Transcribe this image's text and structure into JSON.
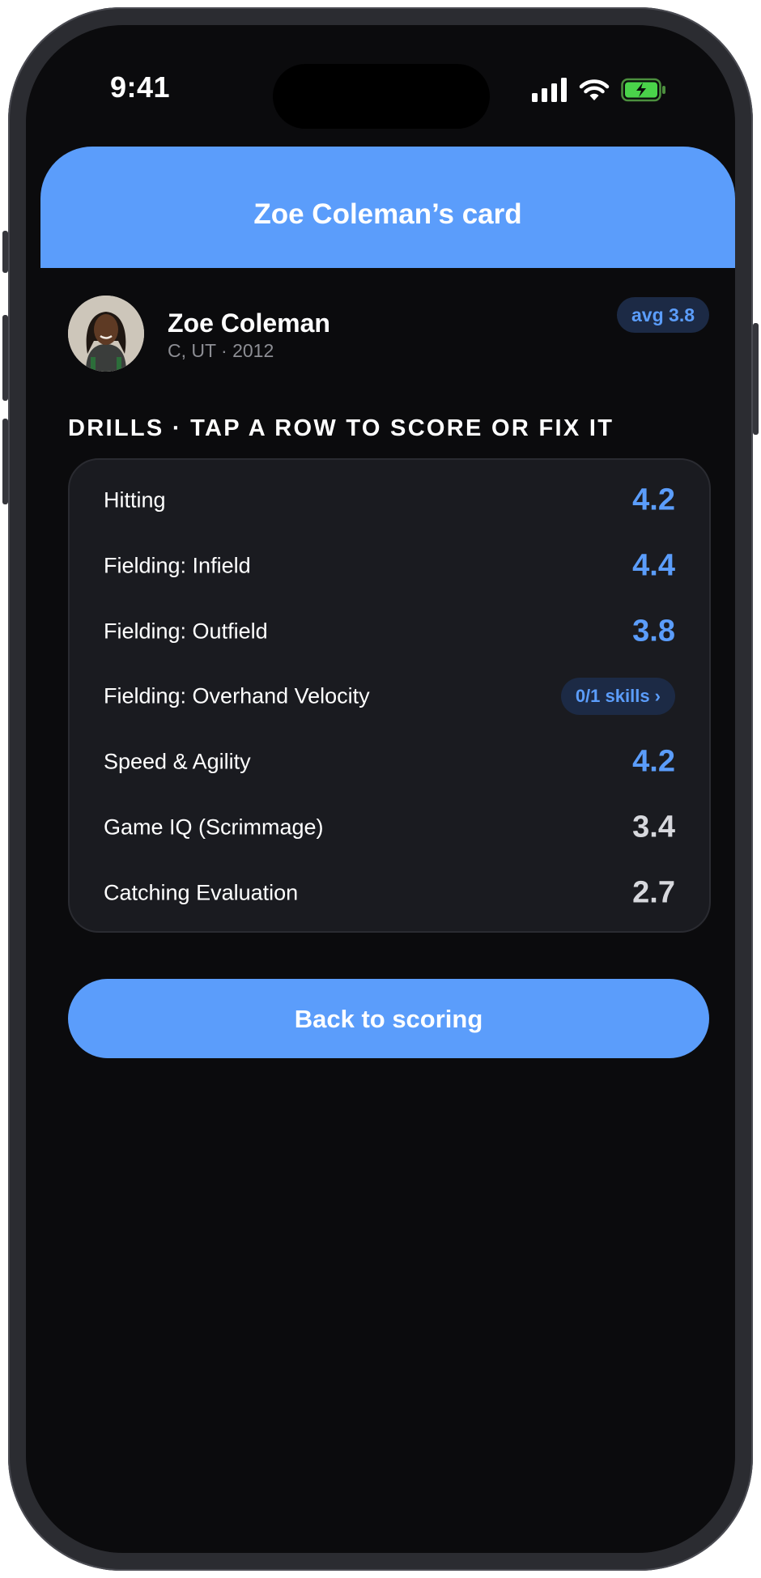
{
  "status_bar": {
    "time": "9:41",
    "signal_icon": "cellular-signal-icon",
    "wifi_icon": "wifi-icon",
    "battery_icon": "battery-charging-icon"
  },
  "header": {
    "title": "Zoe Coleman’s card"
  },
  "profile": {
    "name": "Zoe Coleman",
    "subtitle": "C, UT · 2012",
    "avg_badge": "avg 3.8"
  },
  "drills": {
    "section_label": "DRILLS · TAP A ROW TO SCORE OR FIX IT",
    "rows": [
      {
        "label": "Hitting",
        "score": "4.2",
        "color": "#5b9dfb"
      },
      {
        "label": "Fielding: Infield",
        "score": "4.4",
        "color": "#5b9dfb"
      },
      {
        "label": "Fielding: Outfield",
        "score": "3.8",
        "color": "#5b9dfb"
      },
      {
        "label": "Fielding: Overhand Velocity",
        "chip": "0/1 skills ›"
      },
      {
        "label": "Speed & Agility",
        "score": "4.2",
        "color": "#5b9dfb"
      },
      {
        "label": "Game IQ (Scrimmage)",
        "score": "3.4",
        "color": "#d7d8dd"
      },
      {
        "label": "Catching Evaluation",
        "score": "2.7",
        "color": "#d7d8dd"
      }
    ]
  },
  "actions": {
    "back_label": "Back to scoring"
  },
  "colors": {
    "accent": "#5b9dfb",
    "background": "#0b0b0d",
    "card": "#1a1b20",
    "neutral_score": "#d7d8dd"
  }
}
